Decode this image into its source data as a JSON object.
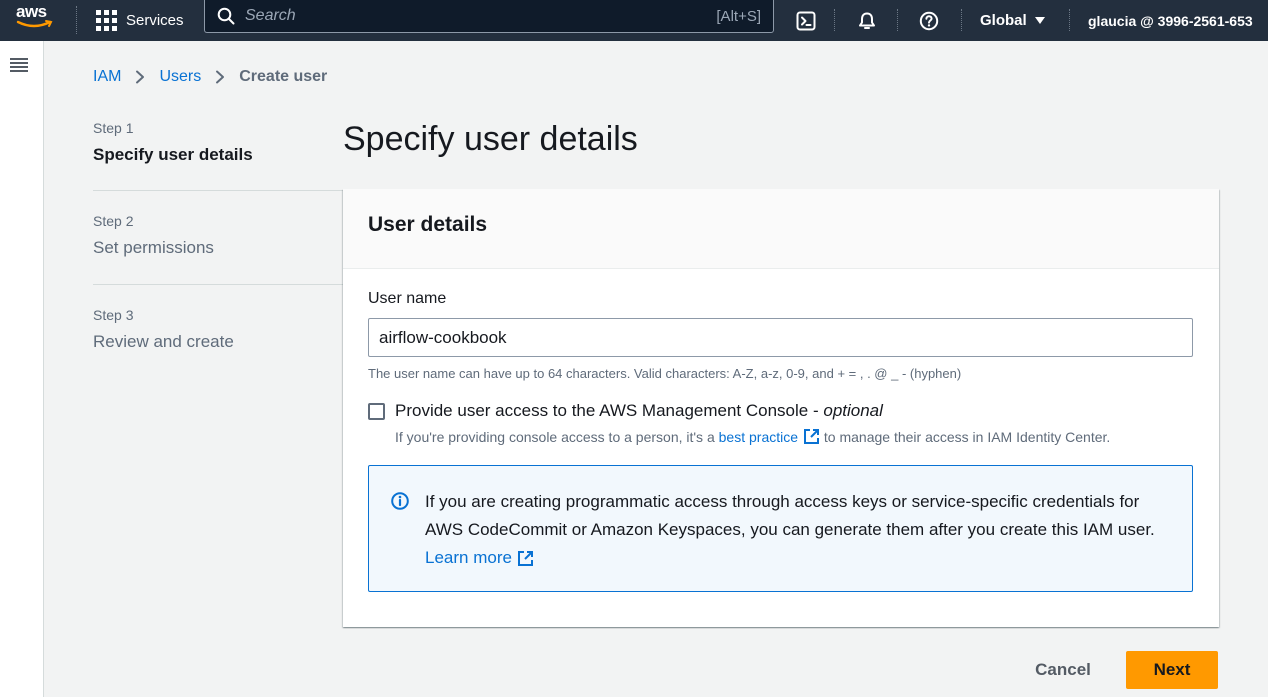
{
  "topnav": {
    "logo_text": "aws",
    "services_label": "Services",
    "search_placeholder": "Search",
    "search_shortcut": "[Alt+S]",
    "region": "Global",
    "account": "glaucia @ 3996-2561-653"
  },
  "breadcrumb": {
    "items": [
      "IAM",
      "Users"
    ],
    "current": "Create user"
  },
  "steps": [
    {
      "number": "Step 1",
      "label": "Specify user details"
    },
    {
      "number": "Step 2",
      "label": "Set permissions"
    },
    {
      "number": "Step 3",
      "label": "Review and create"
    }
  ],
  "page": {
    "title": "Specify user details"
  },
  "user_details": {
    "heading": "User details",
    "username_label": "User name",
    "username_value": "airflow-cookbook",
    "username_hint": "The user name can have up to 64 characters. Valid characters: A-Z, a-z, 0-9, and + = , . @ _ - (hyphen)",
    "console_access_label": "Provide user access to the AWS Management Console - ",
    "console_access_optional": "optional",
    "console_access_desc_before": "If you're providing console access to a person, it's a ",
    "console_access_link": "best practice",
    "console_access_desc_after": " to manage their access in IAM Identity Center.",
    "console_access_checked": false,
    "info_text": "If you are creating programmatic access through access keys or service-specific credentials for AWS CodeCommit or Amazon Keyspaces, you can generate them after you create this IAM user. ",
    "info_link": "Learn more"
  },
  "footer": {
    "cancel_label": "Cancel",
    "next_label": "Next"
  },
  "colors": {
    "nav_bg": "#232f3e",
    "link": "#0972d3",
    "primary_button": "#ff9900",
    "info_border": "#0972d3",
    "info_bg": "#f2f8fd"
  }
}
